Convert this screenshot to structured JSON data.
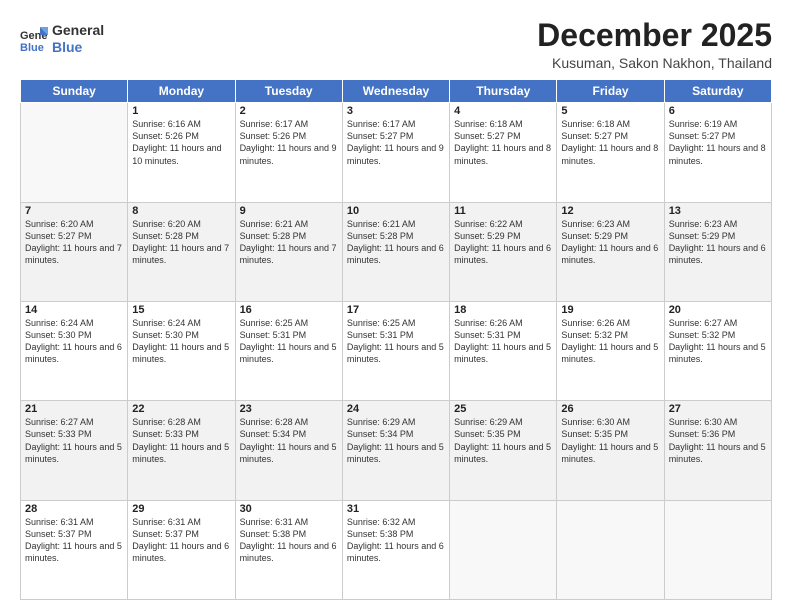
{
  "logo": {
    "line1": "General",
    "line2": "Blue"
  },
  "title": "December 2025",
  "location": "Kusuman, Sakon Nakhon, Thailand",
  "days_of_week": [
    "Sunday",
    "Monday",
    "Tuesday",
    "Wednesday",
    "Thursday",
    "Friday",
    "Saturday"
  ],
  "weeks": [
    [
      {
        "day": "",
        "sunrise": "",
        "sunset": "",
        "daylight": ""
      },
      {
        "day": "1",
        "sunrise": "Sunrise: 6:16 AM",
        "sunset": "Sunset: 5:26 PM",
        "daylight": "Daylight: 11 hours and 10 minutes."
      },
      {
        "day": "2",
        "sunrise": "Sunrise: 6:17 AM",
        "sunset": "Sunset: 5:26 PM",
        "daylight": "Daylight: 11 hours and 9 minutes."
      },
      {
        "day": "3",
        "sunrise": "Sunrise: 6:17 AM",
        "sunset": "Sunset: 5:27 PM",
        "daylight": "Daylight: 11 hours and 9 minutes."
      },
      {
        "day": "4",
        "sunrise": "Sunrise: 6:18 AM",
        "sunset": "Sunset: 5:27 PM",
        "daylight": "Daylight: 11 hours and 8 minutes."
      },
      {
        "day": "5",
        "sunrise": "Sunrise: 6:18 AM",
        "sunset": "Sunset: 5:27 PM",
        "daylight": "Daylight: 11 hours and 8 minutes."
      },
      {
        "day": "6",
        "sunrise": "Sunrise: 6:19 AM",
        "sunset": "Sunset: 5:27 PM",
        "daylight": "Daylight: 11 hours and 8 minutes."
      }
    ],
    [
      {
        "day": "7",
        "sunrise": "Sunrise: 6:20 AM",
        "sunset": "Sunset: 5:27 PM",
        "daylight": "Daylight: 11 hours and 7 minutes."
      },
      {
        "day": "8",
        "sunrise": "Sunrise: 6:20 AM",
        "sunset": "Sunset: 5:28 PM",
        "daylight": "Daylight: 11 hours and 7 minutes."
      },
      {
        "day": "9",
        "sunrise": "Sunrise: 6:21 AM",
        "sunset": "Sunset: 5:28 PM",
        "daylight": "Daylight: 11 hours and 7 minutes."
      },
      {
        "day": "10",
        "sunrise": "Sunrise: 6:21 AM",
        "sunset": "Sunset: 5:28 PM",
        "daylight": "Daylight: 11 hours and 6 minutes."
      },
      {
        "day": "11",
        "sunrise": "Sunrise: 6:22 AM",
        "sunset": "Sunset: 5:29 PM",
        "daylight": "Daylight: 11 hours and 6 minutes."
      },
      {
        "day": "12",
        "sunrise": "Sunrise: 6:23 AM",
        "sunset": "Sunset: 5:29 PM",
        "daylight": "Daylight: 11 hours and 6 minutes."
      },
      {
        "day": "13",
        "sunrise": "Sunrise: 6:23 AM",
        "sunset": "Sunset: 5:29 PM",
        "daylight": "Daylight: 11 hours and 6 minutes."
      }
    ],
    [
      {
        "day": "14",
        "sunrise": "Sunrise: 6:24 AM",
        "sunset": "Sunset: 5:30 PM",
        "daylight": "Daylight: 11 hours and 6 minutes."
      },
      {
        "day": "15",
        "sunrise": "Sunrise: 6:24 AM",
        "sunset": "Sunset: 5:30 PM",
        "daylight": "Daylight: 11 hours and 5 minutes."
      },
      {
        "day": "16",
        "sunrise": "Sunrise: 6:25 AM",
        "sunset": "Sunset: 5:31 PM",
        "daylight": "Daylight: 11 hours and 5 minutes."
      },
      {
        "day": "17",
        "sunrise": "Sunrise: 6:25 AM",
        "sunset": "Sunset: 5:31 PM",
        "daylight": "Daylight: 11 hours and 5 minutes."
      },
      {
        "day": "18",
        "sunrise": "Sunrise: 6:26 AM",
        "sunset": "Sunset: 5:31 PM",
        "daylight": "Daylight: 11 hours and 5 minutes."
      },
      {
        "day": "19",
        "sunrise": "Sunrise: 6:26 AM",
        "sunset": "Sunset: 5:32 PM",
        "daylight": "Daylight: 11 hours and 5 minutes."
      },
      {
        "day": "20",
        "sunrise": "Sunrise: 6:27 AM",
        "sunset": "Sunset: 5:32 PM",
        "daylight": "Daylight: 11 hours and 5 minutes."
      }
    ],
    [
      {
        "day": "21",
        "sunrise": "Sunrise: 6:27 AM",
        "sunset": "Sunset: 5:33 PM",
        "daylight": "Daylight: 11 hours and 5 minutes."
      },
      {
        "day": "22",
        "sunrise": "Sunrise: 6:28 AM",
        "sunset": "Sunset: 5:33 PM",
        "daylight": "Daylight: 11 hours and 5 minutes."
      },
      {
        "day": "23",
        "sunrise": "Sunrise: 6:28 AM",
        "sunset": "Sunset: 5:34 PM",
        "daylight": "Daylight: 11 hours and 5 minutes."
      },
      {
        "day": "24",
        "sunrise": "Sunrise: 6:29 AM",
        "sunset": "Sunset: 5:34 PM",
        "daylight": "Daylight: 11 hours and 5 minutes."
      },
      {
        "day": "25",
        "sunrise": "Sunrise: 6:29 AM",
        "sunset": "Sunset: 5:35 PM",
        "daylight": "Daylight: 11 hours and 5 minutes."
      },
      {
        "day": "26",
        "sunrise": "Sunrise: 6:30 AM",
        "sunset": "Sunset: 5:35 PM",
        "daylight": "Daylight: 11 hours and 5 minutes."
      },
      {
        "day": "27",
        "sunrise": "Sunrise: 6:30 AM",
        "sunset": "Sunset: 5:36 PM",
        "daylight": "Daylight: 11 hours and 5 minutes."
      }
    ],
    [
      {
        "day": "28",
        "sunrise": "Sunrise: 6:31 AM",
        "sunset": "Sunset: 5:37 PM",
        "daylight": "Daylight: 11 hours and 5 minutes."
      },
      {
        "day": "29",
        "sunrise": "Sunrise: 6:31 AM",
        "sunset": "Sunset: 5:37 PM",
        "daylight": "Daylight: 11 hours and 6 minutes."
      },
      {
        "day": "30",
        "sunrise": "Sunrise: 6:31 AM",
        "sunset": "Sunset: 5:38 PM",
        "daylight": "Daylight: 11 hours and 6 minutes."
      },
      {
        "day": "31",
        "sunrise": "Sunrise: 6:32 AM",
        "sunset": "Sunset: 5:38 PM",
        "daylight": "Daylight: 11 hours and 6 minutes."
      },
      {
        "day": "",
        "sunrise": "",
        "sunset": "",
        "daylight": ""
      },
      {
        "day": "",
        "sunrise": "",
        "sunset": "",
        "daylight": ""
      },
      {
        "day": "",
        "sunrise": "",
        "sunset": "",
        "daylight": ""
      }
    ]
  ]
}
